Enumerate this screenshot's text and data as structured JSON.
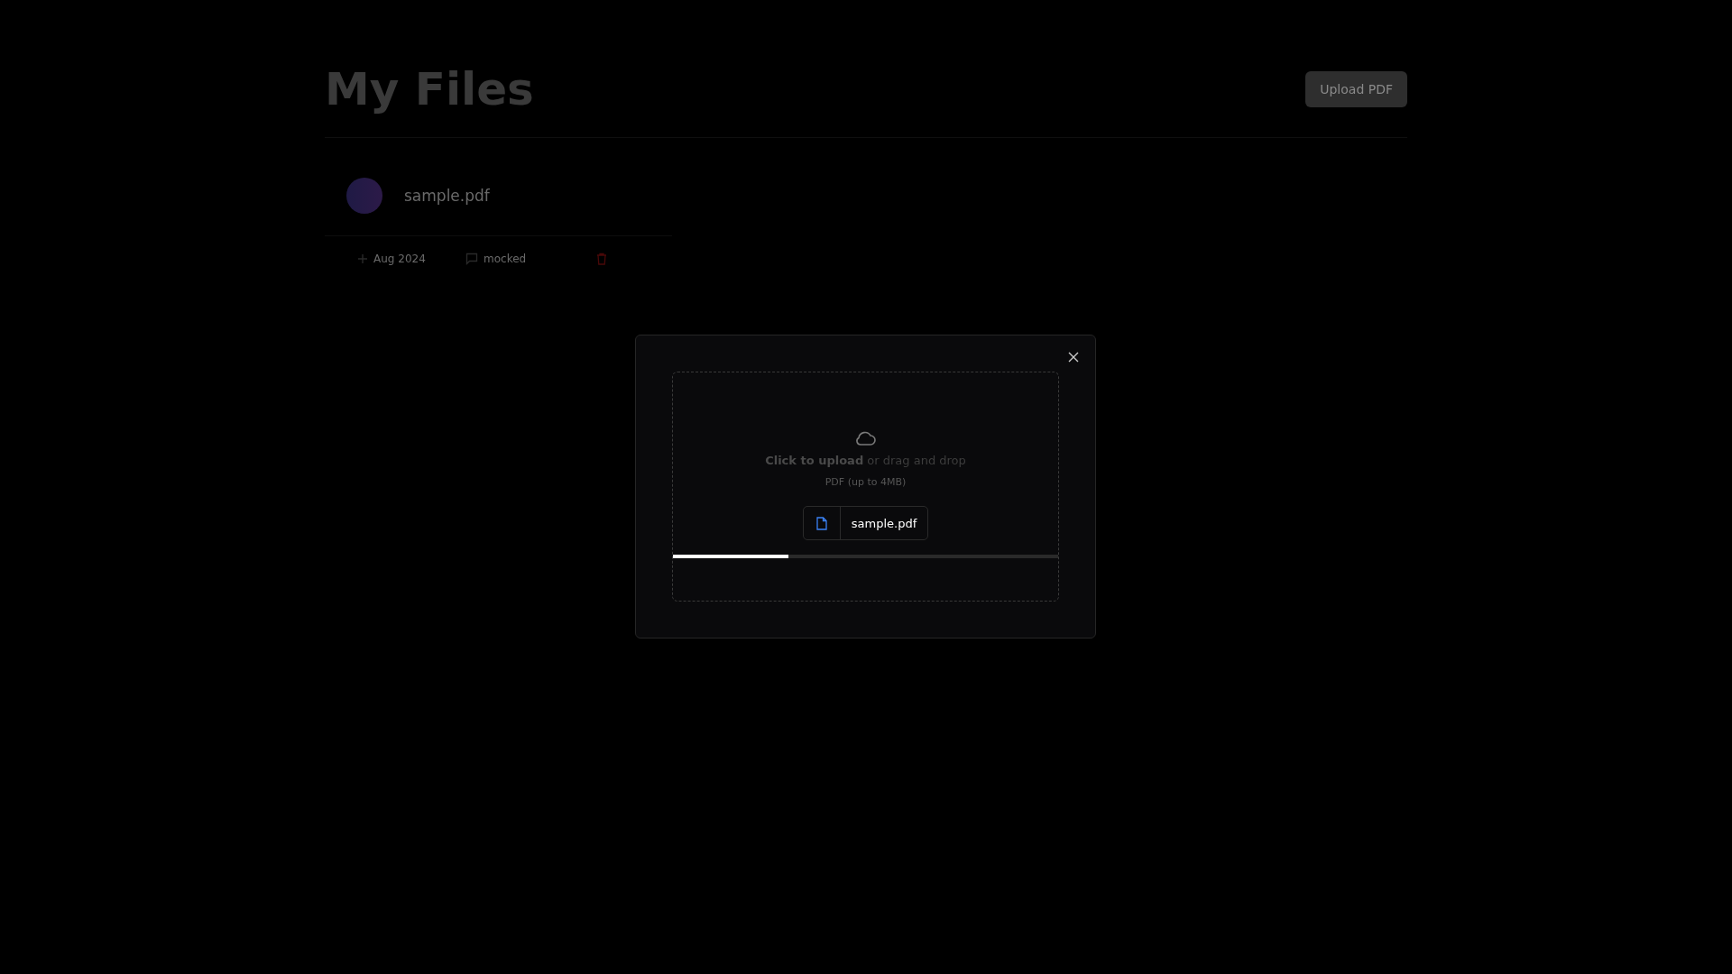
{
  "header": {
    "title": "My Files",
    "upload_button": "Upload PDF"
  },
  "files": [
    {
      "name": "sample.pdf",
      "date": "Aug 2024",
      "status": "mocked"
    }
  ],
  "modal": {
    "prompt": "**Click to upload** or drag and drop",
    "hint": "PDF (up to 4MB)",
    "file_name": "sample.pdf",
    "level": 0.3
  }
}
